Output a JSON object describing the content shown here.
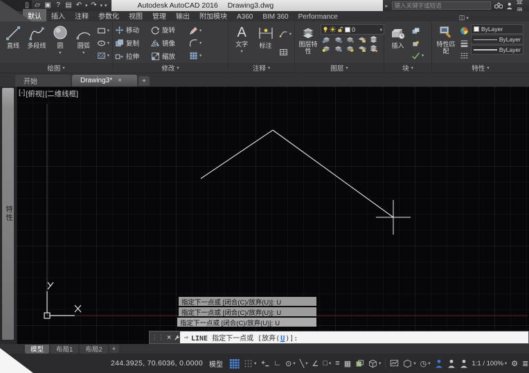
{
  "title_bar": {
    "app_title": "Autodesk AutoCAD 2016",
    "doc_title": "Drawing3.dwg",
    "search_placeholder": "键入关键字或短语",
    "sign_in": "登录"
  },
  "icons": {
    "dropdown": "▾",
    "new_file": "▯",
    "open_file": "▱",
    "save_file": "▣",
    "plot": "▤",
    "help": "?",
    "undo": "↶",
    "redo": "↷",
    "expand": "▸",
    "ribbon_toggle": "◫",
    "close": "×",
    "plus": "+",
    "grip": "⋮⋮",
    "prompt_opt": "▪▾",
    "ortho": "∟",
    "angle": "∠",
    "lineweight": "≡",
    "snap_track": "╲",
    "polar": "⊙",
    "transparency": "▦",
    "osnap_square": "□",
    "clock": "◷",
    "gear": "⚙",
    "hamburger": "≣",
    "text_glyph": "A"
  },
  "ribbon_tabs": {
    "items": [
      {
        "label": "默认",
        "active": true
      },
      {
        "label": "插入",
        "active": false
      },
      {
        "label": "注释",
        "active": false
      },
      {
        "label": "参数化",
        "active": false
      },
      {
        "label": "视图",
        "active": false
      },
      {
        "label": "管理",
        "active": false
      },
      {
        "label": "输出",
        "active": false
      },
      {
        "label": "附加模块",
        "active": false
      },
      {
        "label": "A360",
        "active": false
      },
      {
        "label": "BIM 360",
        "active": false
      },
      {
        "label": "Performance",
        "active": false
      }
    ]
  },
  "ribbon": {
    "draw": {
      "label": "绘图",
      "buttons": [
        "直线",
        "多段线",
        "圆",
        "圆弧"
      ]
    },
    "modify": {
      "label": "修改",
      "buttons": [
        "移动",
        "旋转",
        "复制",
        "镜像",
        "拉伸",
        "缩放"
      ]
    },
    "annotate": {
      "label": "注释",
      "text_button": "文字",
      "dim_button": "标注"
    },
    "layers": {
      "label": "图层",
      "properties_button": "图层特性",
      "current_layer": "0"
    },
    "block": {
      "label": "块",
      "insert_button": "插入"
    },
    "properties": {
      "label": "特性",
      "match_button": "特性匹配",
      "color_value": "ByLayer",
      "lineweight_value": "ByLayer",
      "linetype_value": "ByLayer"
    }
  },
  "file_tabs": {
    "start": "开始",
    "drawing": "Drawing3*"
  },
  "viewport_label": {
    "minimize": "[-]",
    "view": "[俯视]",
    "visual_style": "[二维线框]"
  },
  "palette": {
    "title": "特性"
  },
  "canvas": {
    "axis_x_label": "X",
    "axis_y_label": "Y"
  },
  "command_history": {
    "lines": [
      "指定下一点或 [闭合(C)/放弃(U)]: U",
      "指定下一点或 [闭合(C)/放弃(U)]: U",
      "指定下一点或 [闭合(C)/放弃(U)]: U"
    ]
  },
  "command_line": {
    "command": "LINE",
    "prompt_pre": " 指定下一点或 [放弃(",
    "option_key": "U",
    "prompt_post": ")]:"
  },
  "layout_tabs": {
    "model": "模型",
    "layout1": "布局1",
    "layout2": "布局2"
  },
  "status_bar": {
    "coordinates": "244.3925, 70.6036, 0.0000",
    "model_button": "模型",
    "annotation_scale": "1:1 / 100%"
  }
}
